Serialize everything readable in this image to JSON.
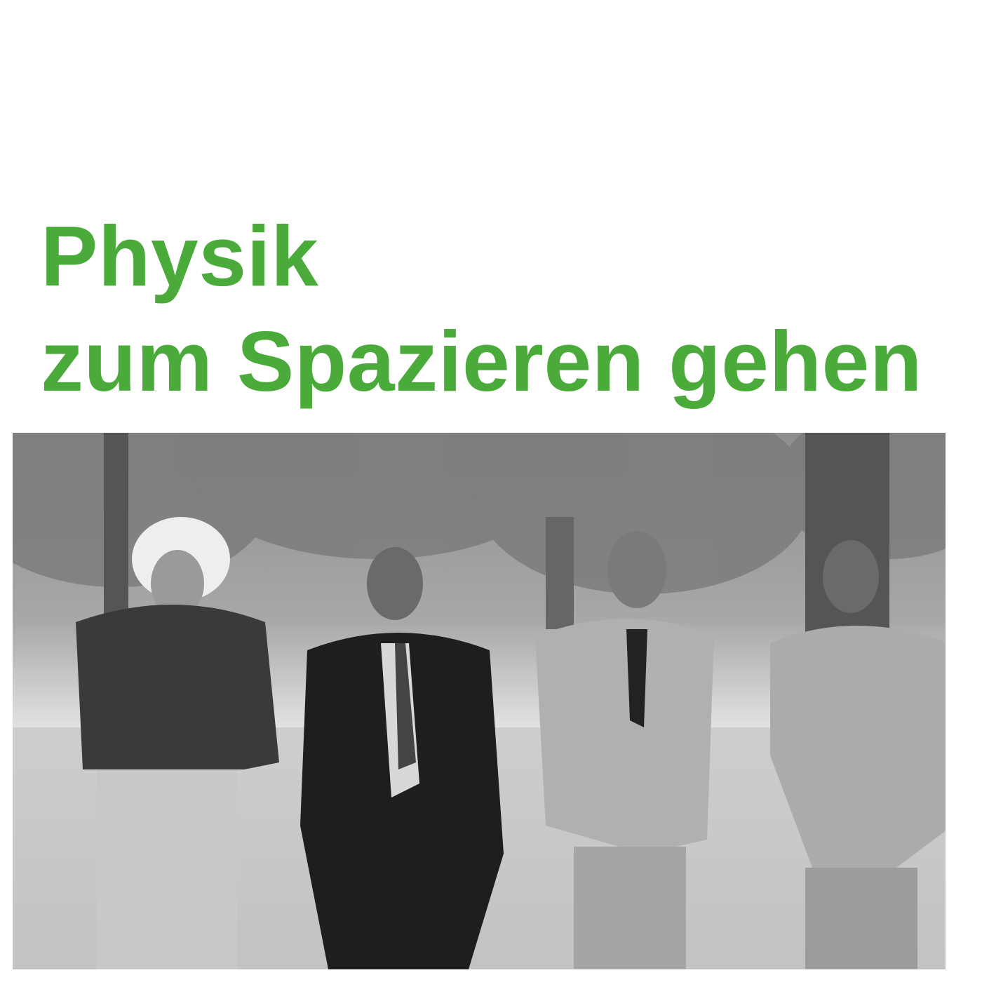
{
  "title": {
    "line1": "Physik",
    "line2": "zum Spazieren gehen",
    "color": "#4aab3a"
  },
  "photo": {
    "style": "black-and-white"
  }
}
